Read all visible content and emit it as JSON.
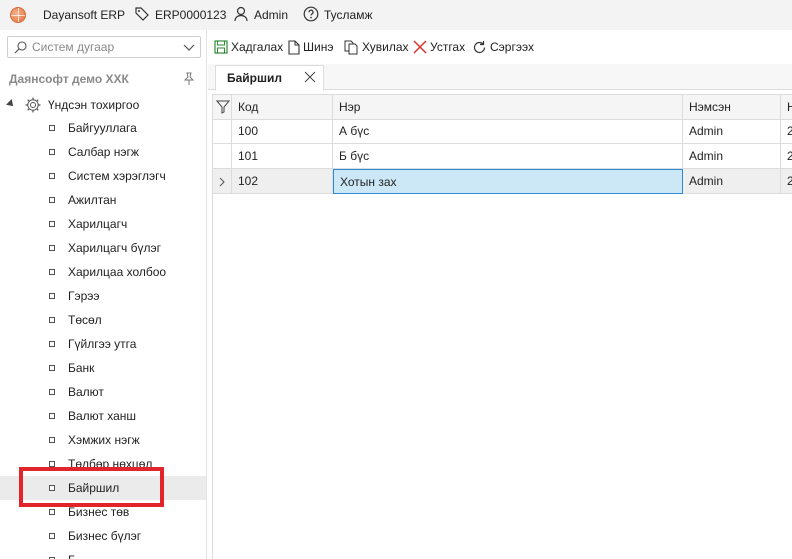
{
  "titlebar": {
    "app_name": "Dayansoft ERP",
    "doc_code": "ERP0000123",
    "user": "Admin",
    "help": "Тусламж"
  },
  "left_panel": {
    "search_placeholder": "Систем дугаар",
    "company": "Даянсофт демо ХХК",
    "root_label": "Үндсэн тохиргоо",
    "items": [
      {
        "label": "Байгууллага"
      },
      {
        "label": "Салбар нэгж"
      },
      {
        "label": "Систем хэрэглэгч"
      },
      {
        "label": "Ажилтан"
      },
      {
        "label": "Харилцагч"
      },
      {
        "label": "Харилцагч бүлэг"
      },
      {
        "label": "Харилцаа холбоо"
      },
      {
        "label": "Гэрээ"
      },
      {
        "label": "Төсөл"
      },
      {
        "label": "Гүйлгээ утга"
      },
      {
        "label": "Банк"
      },
      {
        "label": "Валют"
      },
      {
        "label": "Валют ханш"
      },
      {
        "label": "Хэмжих нэгж"
      },
      {
        "label": "Төлбөр нөхцөл"
      },
      {
        "label": "Байршил"
      },
      {
        "label": "Бизнес төв"
      },
      {
        "label": "Бизнес бүлэг"
      },
      {
        "label": "Г..."
      }
    ],
    "selected_index": 15
  },
  "toolbar": {
    "save": "Хадгалах",
    "new": "Шинэ",
    "copy": "Хувилах",
    "delete": "Устгах",
    "refresh": "Сэргээх"
  },
  "tab": {
    "label": "Байршил"
  },
  "grid": {
    "columns": [
      "Код",
      "Нэр",
      "Нэмсэн",
      "Н"
    ],
    "rows": [
      {
        "code": "100",
        "name": "А бүс",
        "added": "Admin",
        "extra": "2"
      },
      {
        "code": "101",
        "name": "Б бүс",
        "added": "Admin",
        "extra": "2"
      },
      {
        "code": "102",
        "name": "Хотын зах",
        "added": "Admin",
        "extra": "2"
      }
    ],
    "current_row_index": 2
  },
  "colors": {
    "accent": "#2f8bd2",
    "highlight": "#e0262a",
    "save_icon": "#2e8b3a",
    "delete_icon": "#d9332c"
  }
}
